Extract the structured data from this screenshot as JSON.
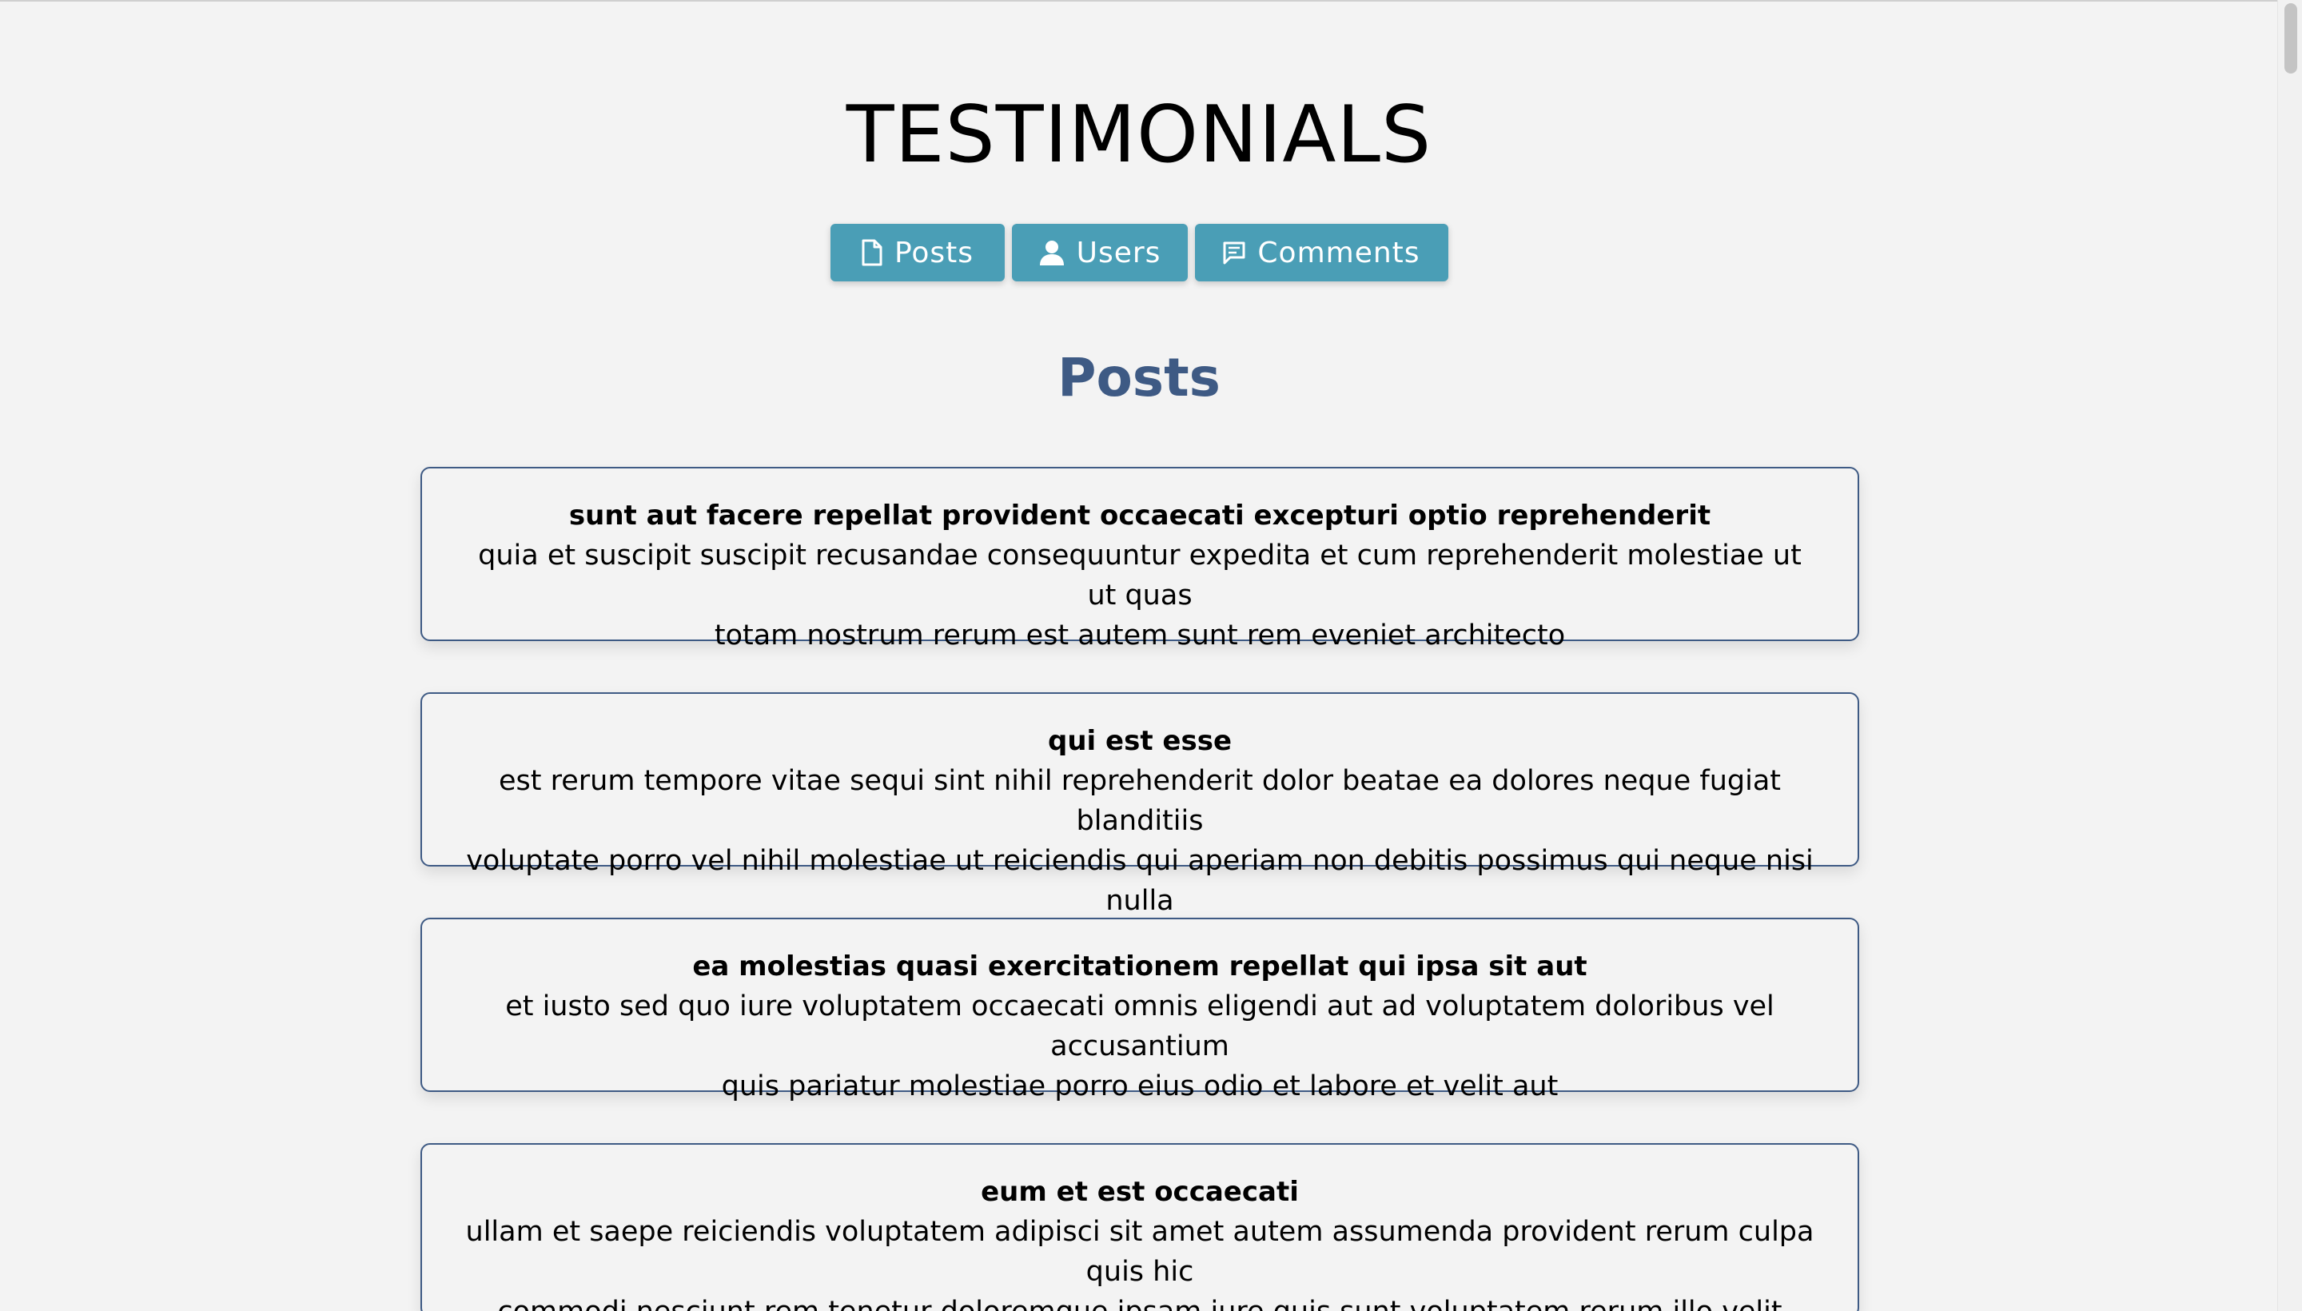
{
  "header": {
    "title": "TESTIMONIALS"
  },
  "nav": {
    "buttons": [
      {
        "label": "Posts",
        "icon": "document-icon"
      },
      {
        "label": "Users",
        "icon": "user-icon"
      },
      {
        "label": "Comments",
        "icon": "comment-icon"
      }
    ]
  },
  "section": {
    "title": "Posts"
  },
  "posts": [
    {
      "title": "sunt aut facere repellat provident occaecati excepturi optio reprehenderit",
      "body_line1": "quia et suscipit suscipit recusandae consequuntur expedita et cum reprehenderit molestiae ut ut quas",
      "body_line2": "totam nostrum rerum est autem sunt rem eveniet architecto"
    },
    {
      "title": "qui est esse",
      "body_line1": "est rerum tempore vitae sequi sint nihil reprehenderit dolor beatae ea dolores neque fugiat blanditiis",
      "body_line2": "voluptate porro vel nihil molestiae ut reiciendis qui aperiam non debitis possimus qui neque nisi nulla"
    },
    {
      "title": "ea molestias quasi exercitationem repellat qui ipsa sit aut",
      "body_line1": "et iusto sed quo iure voluptatem occaecati omnis eligendi aut ad voluptatem doloribus vel accusantium",
      "body_line2": "quis pariatur molestiae porro eius odio et labore et velit aut"
    },
    {
      "title": "eum et est occaecati",
      "body_line1": "ullam et saepe reiciendis voluptatem adipisci sit amet autem assumenda provident rerum culpa quis hic",
      "body_line2": "commodi nesciunt rem tenetur doloremque ipsam iure quis sunt voluptatem rerum illo velit"
    }
  ],
  "colors": {
    "background": "#f3f3f3",
    "button": "#4a9eb6",
    "accent": "#3e5a84"
  }
}
